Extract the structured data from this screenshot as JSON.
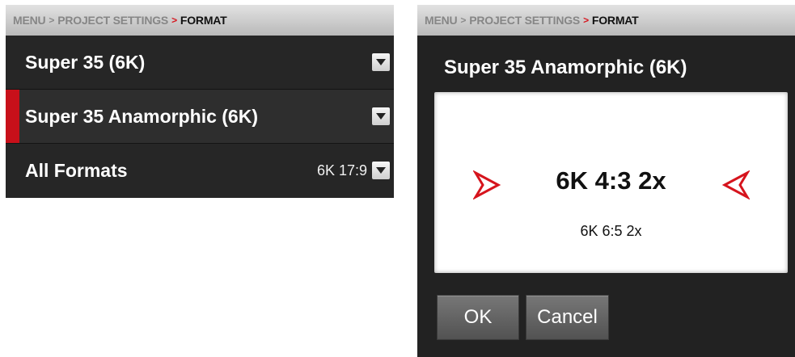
{
  "breadcrumb": {
    "menu": "MENU",
    "sep1": ">",
    "project_settings": "PROJECT SETTINGS",
    "sep2": ">",
    "current": "FORMAT"
  },
  "format_list": {
    "items": [
      {
        "label": "Super 35 (6K)",
        "value": "",
        "selected": false
      },
      {
        "label": "Super 35 Anamorphic (6K)",
        "value": "",
        "selected": true
      },
      {
        "label": "All Formats",
        "value": "6K 17:9",
        "selected": false
      }
    ]
  },
  "dialog": {
    "title": "Super 35 Anamorphic (6K)",
    "selected_option": "6K 4:3 2x",
    "next_option": "6K 6:5 2x",
    "ok_label": "OK",
    "cancel_label": "Cancel"
  },
  "colors": {
    "accent_red": "#c8101a",
    "panel_bg": "#262626",
    "breadcrumb_bg": "#d0d0d0"
  },
  "icons": {
    "dropdown": "chevron-down-icon",
    "prev": "arrow-left-icon",
    "next": "arrow-right-icon"
  }
}
